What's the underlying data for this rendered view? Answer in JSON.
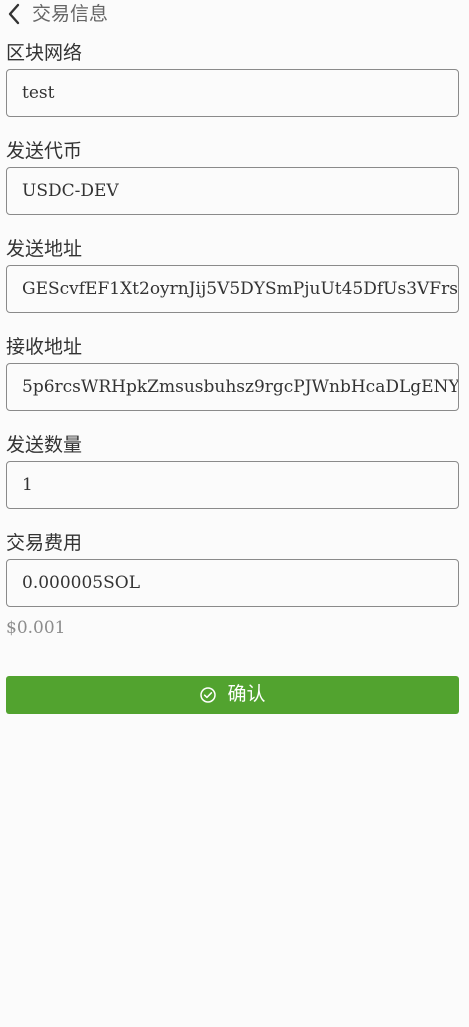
{
  "header": {
    "title": "交易信息",
    "back_icon": "chevron-left-icon"
  },
  "fields": [
    {
      "label": "区块网络",
      "value": "test"
    },
    {
      "label": "发送代币",
      "value": "USDC-DEV"
    },
    {
      "label": "发送地址",
      "value": "GEScvfEF1Xt2oyrnJij5V5DYSmPjuUt45DfUs3VFrs"
    },
    {
      "label": "接收地址",
      "value": "5p6rcsWRHpkZmsusbuhsz9rgcPJWnbHcaDLgENY"
    },
    {
      "label": "发送数量",
      "value": "1"
    },
    {
      "label": "交易费用",
      "value": "0.000005SOL"
    }
  ],
  "fee_usd": "$0.001",
  "confirm": {
    "label": "确认",
    "icon": "check-circle-icon",
    "color": "#52a32f"
  }
}
